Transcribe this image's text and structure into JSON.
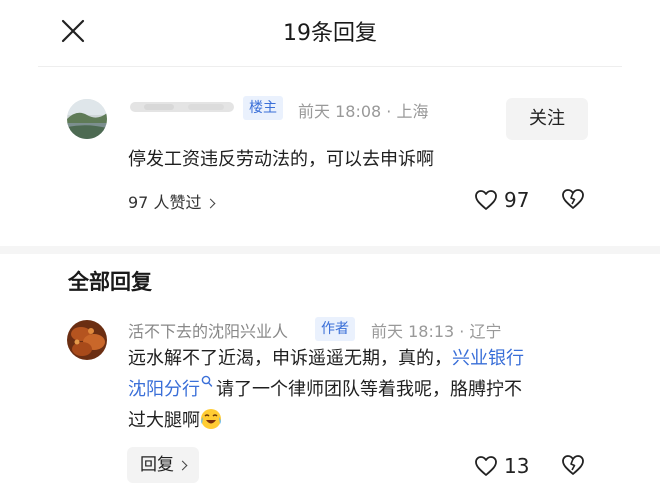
{
  "header": {
    "title": "19条回复",
    "close_icon": "close-icon"
  },
  "main_comment": {
    "avatar_icon": "avatar-landscape",
    "badge": "楼主",
    "meta": "前天 18:08 · 上海",
    "follow_label": "关注",
    "text": "停发工资违反劳动法的，可以去申诉啊",
    "likes_summary": "97 人赞过",
    "like_count": "97",
    "like_icon": "heart-icon",
    "dislike_icon": "broken-heart-icon"
  },
  "replies_section": {
    "title": "全部回复"
  },
  "reply": {
    "avatar_icon": "avatar-food",
    "author": "活不下去的沈阳兴业人",
    "badge": "作者",
    "meta": "前天 18:13 · 辽宁",
    "text_line1_before": "远水解不了近渴，申诉遥遥无期，真的，",
    "link_part1": "兴业银行",
    "link_part2": "沈阳分行",
    "text_line2_after": "请了一个律师团队等着我呢，胳膊拧不",
    "text_line3": "过大腿啊",
    "reply_label": "回复",
    "like_count": "13",
    "like_icon": "heart-icon",
    "dislike_icon": "broken-heart-icon",
    "emoji_icon": "crying-laughing-emoji-icon",
    "search_icon": "search-icon"
  },
  "colors": {
    "link": "#3a6fd8",
    "badge_bg": "#eaf1fd",
    "meta": "#999999"
  }
}
